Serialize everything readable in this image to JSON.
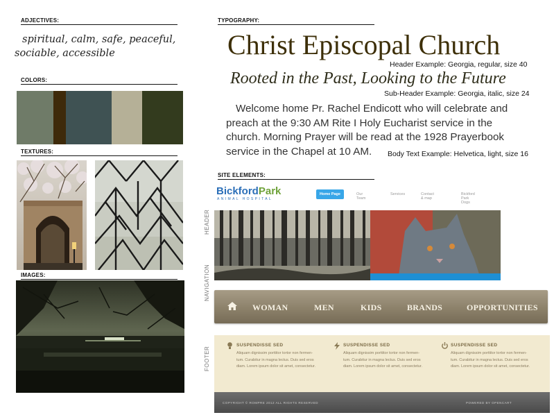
{
  "adjectives": {
    "label": "ADJECTIVES:",
    "line1": "spiritual, calm, safe, peaceful,",
    "line2": "sociable, accessible"
  },
  "colors": {
    "label": "COLORS:",
    "swatches": [
      "#6f7b68",
      "#3e2a0a",
      "#3f5253",
      "#b5b097",
      "#333b1e"
    ]
  },
  "textures": {
    "label": "TEXTURES:"
  },
  "images": {
    "label": "IMAGES:"
  },
  "typography": {
    "label": "TYPOGRAPHY:",
    "header_text": "Christ Episcopal Church",
    "header_note": "Header Example: Georgia, regular, size 40",
    "subheader_text": "Rooted in the Past, Looking to the Future",
    "subheader_note": "Sub-Header Example: Georgia, italic, size 24",
    "body_line1": "Welcome home Pr. Rachel Endicott who will celebrate and",
    "body_line2": "preach at the 9:30 AM Rite I Holy Eucharist service in the",
    "body_line3": "church. Morning Prayer will be read at the 1928 Prayerbook",
    "body_line4": "service in the Chapel at 10 AM.",
    "body_note": "Body Text Example: Helvetica, light, size 16"
  },
  "site_elements": {
    "label": "SITE ELEMENTS:",
    "side_header": "HEADER",
    "side_navigation": "NAVIGATION",
    "side_footer": "FOOTER",
    "header_example": {
      "logo_main_1": "Bickford",
      "logo_main_2": "Park",
      "logo_sub": "ANIMAL HOSPITAL",
      "nav": [
        "Home Page",
        "Our Team",
        "Services",
        "Contact & map",
        "Bickford Park Dogs"
      ]
    },
    "nav_example": {
      "items": [
        "WOMAN",
        "MEN",
        "KIDS",
        "BRANDS",
        "OPPORTUNITIES"
      ]
    },
    "footer_example": {
      "columns": [
        {
          "icon": "lightbulb-icon",
          "title": "SUSPENDISSE SED",
          "l1": "Aliquam dignissim porttitor tortor non fermen-",
          "l2": "tum. Curabitur in magna lectus. Duis sed eros",
          "l3": "diam. Lorem ipsum dolor sit amet, consectetur."
        },
        {
          "icon": "lightning-icon",
          "title": "SUSPENDISSE SED",
          "l1": "Aliquam dignissim porttitor tortor non fermen-",
          "l2": "tum. Curabitur in magna lectus. Duis sed eros",
          "l3": "diam. Lorem ipsum dolor sit amet, consectetur."
        },
        {
          "icon": "power-icon",
          "title": "SUSPENDISSE SED",
          "l1": "Aliquam dignissim porttitor tortor non fermen-",
          "l2": "tum. Curabitur in magna lectus. Duis sed eros",
          "l3": "diam. Lorem ipsum dolor sit amet, consectetur."
        }
      ],
      "copyright": "COPYRIGHT © ROMPRE 2012 ALL RIGHTS RESERVED",
      "powered": "POWERED BY OPENCART"
    }
  }
}
